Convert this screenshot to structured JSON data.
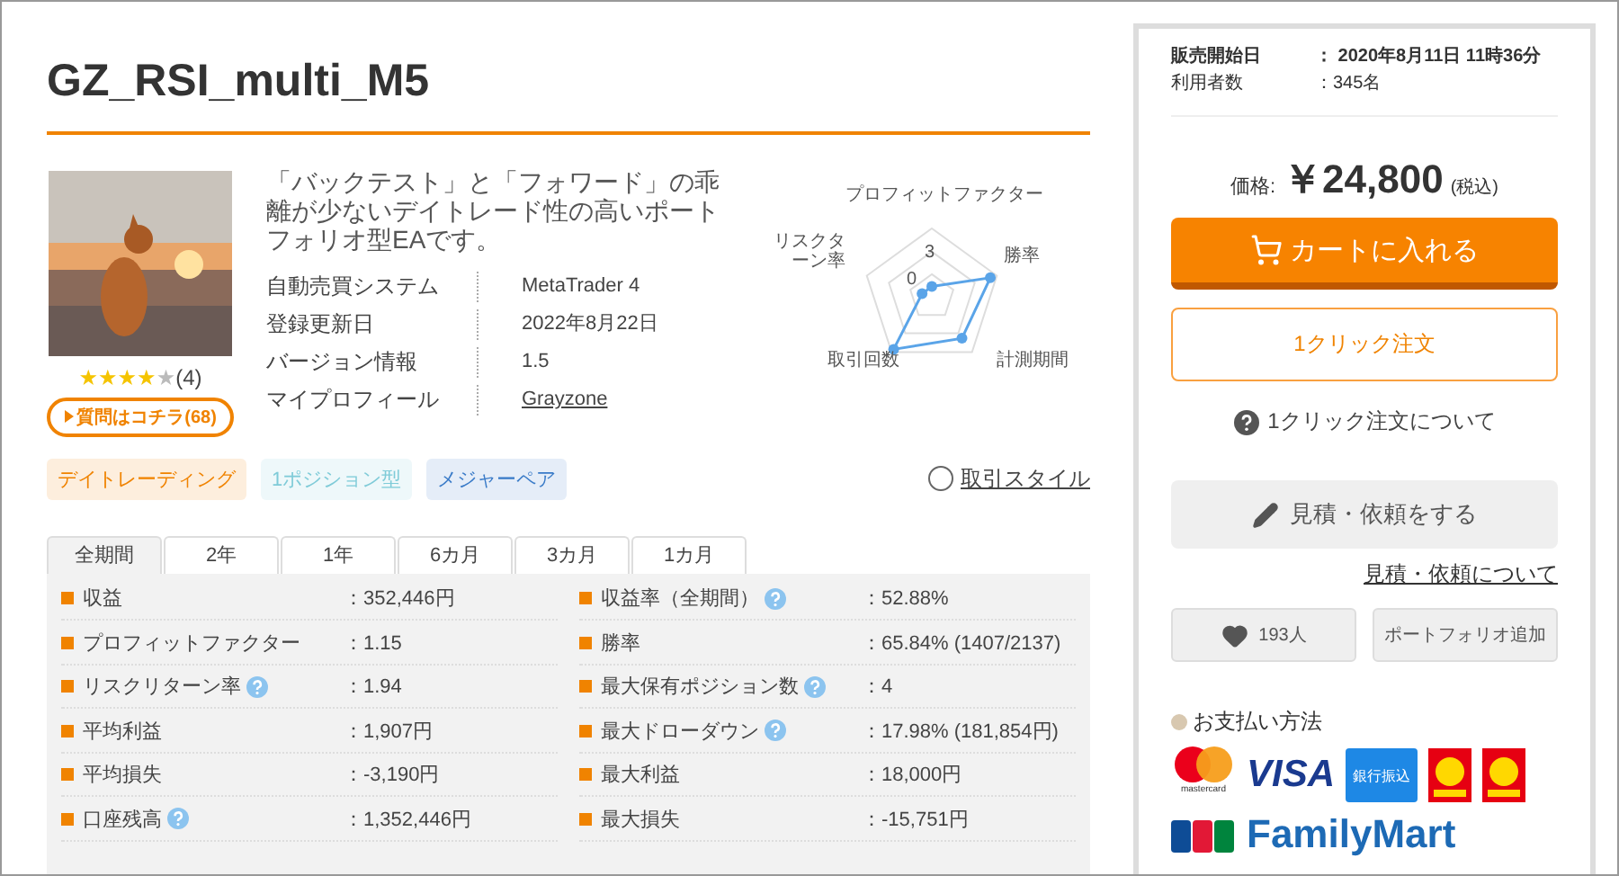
{
  "title": "GZ_RSI_multi_M5",
  "product": {
    "stars": 4,
    "review_count": "(4)",
    "question_button": "質問はコチラ(68)",
    "description": "「バックテスト」と「フォワード」の乖離が少ないデイトレード性の高いポートフォリオ型EAです。",
    "info": [
      {
        "label": "自動売買システム",
        "value": "MetaTrader 4",
        "link": false
      },
      {
        "label": "登録更新日",
        "value": "2022年8月22日",
        "link": false
      },
      {
        "label": "バージョン情報",
        "value": "1.5",
        "link": false
      },
      {
        "label": "マイプロフィール",
        "value": "Grayzone",
        "link": true
      }
    ],
    "radar": {
      "labels": [
        "プロフィットファクター",
        "リスクターン率",
        "勝率",
        "取引回数",
        "計測期間"
      ],
      "ticks": [
        "3",
        "0"
      ]
    },
    "tags": [
      {
        "label": "デイトレーディング",
        "color": "#f08300"
      },
      {
        "label": "1ポジション型",
        "color": "#7fcbd8"
      },
      {
        "label": "メジャーペア",
        "color": "#3a7bc8"
      }
    ],
    "style_link": "取引スタイル"
  },
  "tabs": [
    {
      "label": "全期間",
      "selected": true
    },
    {
      "label": "2年",
      "selected": false
    },
    {
      "label": "1年",
      "selected": false
    },
    {
      "label": "6カ月",
      "selected": false
    },
    {
      "label": "3カ月",
      "selected": false
    },
    {
      "label": "1カ月",
      "selected": false
    }
  ],
  "stats_left": [
    {
      "label": "収益",
      "value": "：352,446円",
      "help": false
    },
    {
      "label": "プロフィットファクター",
      "value": "：1.15",
      "help": false
    },
    {
      "label": "リスクリターン率",
      "value": "：1.94",
      "help": true
    },
    {
      "label": "平均利益",
      "value": "：1,907円",
      "help": false
    },
    {
      "label": "平均損失",
      "value": "：-3,190円",
      "help": false
    },
    {
      "label": "口座残高",
      "value": "：1,352,446円",
      "help": true
    }
  ],
  "stats_right": [
    {
      "label": "収益率（全期間）",
      "value": "：52.88%",
      "help": true
    },
    {
      "label": "勝率",
      "value": "：65.84% (1407/2137)",
      "help": false
    },
    {
      "label": "最大保有ポジション数",
      "value": "：4",
      "help": true
    },
    {
      "label": "最大ドローダウン",
      "value": "：17.98% (181,854円)",
      "help": true
    },
    {
      "label": "最大利益",
      "value": "：18,000円",
      "help": false
    },
    {
      "label": "最大損失",
      "value": "：-15,751円",
      "help": false
    }
  ],
  "sidebar": {
    "sale_info": [
      {
        "label": "販売開始日",
        "value": "：  2020年8月11日 11時36分",
        "bold": true
      },
      {
        "label": "利用者数",
        "value": "：345名",
        "bold": false
      }
    ],
    "price_label": "価格:",
    "price": "￥24,800",
    "tax": "(税込)",
    "cart_button": "カートに入れる",
    "one_click_button": "1クリック注文",
    "one_click_about": "1クリック注文について",
    "estimate_button": "見積・依頼をする",
    "estimate_link": "見積・依頼について",
    "favorite_count": "193人",
    "portfolio_button": "ポートフォリオ追加",
    "payment_title": "お支払い方法",
    "payment_logos": [
      {
        "kind": "mastercard",
        "text": "mastercard"
      },
      {
        "kind": "visa",
        "text": "VISA"
      },
      {
        "kind": "bank",
        "text": "銀行振込"
      },
      {
        "kind": "daily"
      },
      {
        "kind": "daily"
      },
      {
        "kind": "jcb"
      },
      {
        "kind": "familymart",
        "text": "FamilyMart"
      }
    ]
  }
}
